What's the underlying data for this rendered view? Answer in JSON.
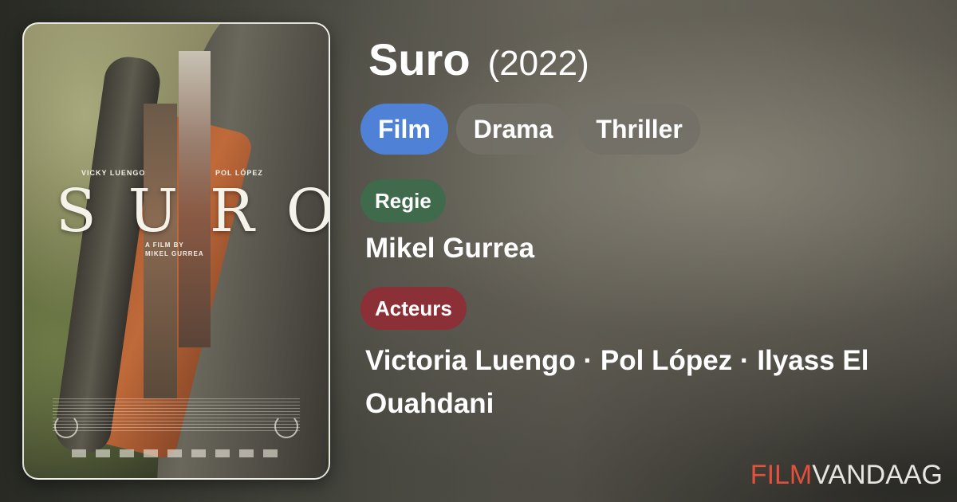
{
  "movie": {
    "title": "Suro",
    "year": "(2022)"
  },
  "genres": [
    {
      "label": "Film",
      "active": true
    },
    {
      "label": "Drama",
      "active": false
    },
    {
      "label": "Thriller",
      "active": false
    }
  ],
  "director": {
    "label": "Regie",
    "name": "Mikel Gurrea"
  },
  "cast": {
    "label": "Acteurs",
    "names": "Victoria Luengo · Pol López · Ilyass El Ouahdani"
  },
  "poster": {
    "credit_left": "VICKY LUENGO",
    "credit_right": "POL LÓPEZ",
    "title": "SURO",
    "director_line1": "A FILM BY",
    "director_line2": "MIKEL GURREA"
  },
  "brand": {
    "part1": "FILM",
    "part2": "VANDAAG"
  },
  "colors": {
    "active_chip": "#4f82d6",
    "regie_pill": "#3f6b4c",
    "acteurs_pill": "#8c3038",
    "brand_accent": "#e2503e"
  }
}
